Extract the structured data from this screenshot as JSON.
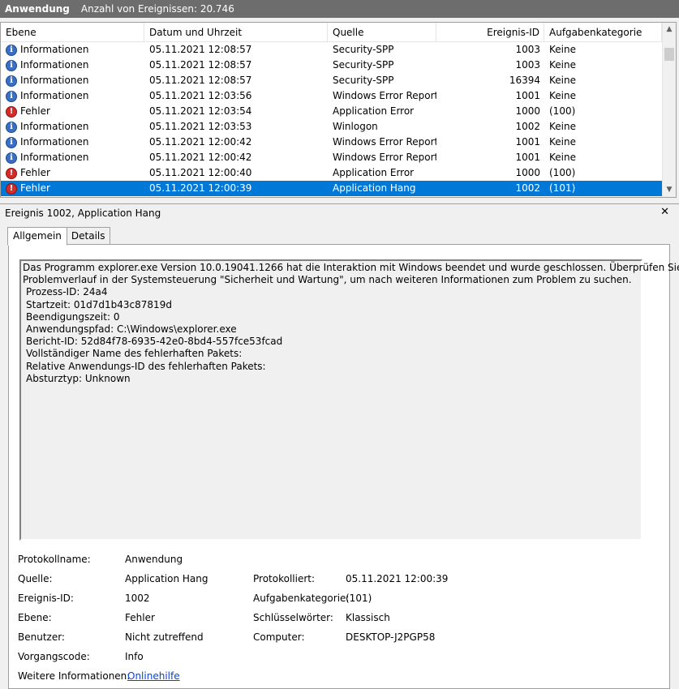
{
  "title": {
    "app": "Anwendung",
    "count": "Anzahl von Ereignissen: 20.746"
  },
  "columns": {
    "level": "Ebene",
    "date": "Datum und Uhrzeit",
    "source": "Quelle",
    "id": "Ereignis-ID",
    "category": "Aufgabenkategorie"
  },
  "rows": [
    {
      "icon": "info-icon",
      "level": "Informationen",
      "date": "05.11.2021 12:08:57",
      "source": "Security-SPP",
      "id": "1003",
      "category": "Keine"
    },
    {
      "icon": "info-icon",
      "level": "Informationen",
      "date": "05.11.2021 12:08:57",
      "source": "Security-SPP",
      "id": "1003",
      "category": "Keine"
    },
    {
      "icon": "info-icon",
      "level": "Informationen",
      "date": "05.11.2021 12:08:57",
      "source": "Security-SPP",
      "id": "16394",
      "category": "Keine"
    },
    {
      "icon": "info-icon",
      "level": "Informationen",
      "date": "05.11.2021 12:03:56",
      "source": "Windows Error Report...",
      "id": "1001",
      "category": "Keine"
    },
    {
      "icon": "error-icon",
      "level": "Fehler",
      "date": "05.11.2021 12:03:54",
      "source": "Application Error",
      "id": "1000",
      "category": "(100)"
    },
    {
      "icon": "info-icon",
      "level": "Informationen",
      "date": "05.11.2021 12:03:53",
      "source": "Winlogon",
      "id": "1002",
      "category": "Keine"
    },
    {
      "icon": "info-icon",
      "level": "Informationen",
      "date": "05.11.2021 12:00:42",
      "source": "Windows Error Report...",
      "id": "1001",
      "category": "Keine"
    },
    {
      "icon": "info-icon",
      "level": "Informationen",
      "date": "05.11.2021 12:00:42",
      "source": "Windows Error Report...",
      "id": "1001",
      "category": "Keine"
    },
    {
      "icon": "error-icon",
      "level": "Fehler",
      "date": "05.11.2021 12:00:40",
      "source": "Application Error",
      "id": "1000",
      "category": "(100)"
    },
    {
      "icon": "error-icon",
      "level": "Fehler",
      "date": "05.11.2021 12:00:39",
      "source": "Application Hang",
      "id": "1002",
      "category": "(101)",
      "selected": true
    }
  ],
  "detail": {
    "header": "Ereignis 1002, Application Hang",
    "close": "✕",
    "tab_general": "Allgemein",
    "tab_details": "Details"
  },
  "message": [
    "Das Programm explorer.exe Version 10.0.19041.1266 hat die Interaktion mit Windows beendet und wurde geschlossen. Überprüfen Sie den",
    "Problemverlauf in der Systemsteuerung \"Sicherheit und Wartung\", um nach weiteren Informationen zum Problem zu suchen.",
    " Prozess-ID: 24a4",
    " Startzeit: 01d7d1b43c87819d",
    " Beendigungszeit: 0",
    " Anwendungspfad: C:\\Windows\\explorer.exe",
    " Bericht-ID: 52d84f78-6935-42e0-8bd4-557fce53fcad",
    " Vollständiger Name des fehlerhaften Pakets:",
    " Relative Anwendungs-ID des fehlerhaften Pakets:",
    " Absturztyp: Unknown"
  ],
  "properties": {
    "logname_label": "Protokollname:",
    "logname_value": "Anwendung",
    "source_label": "Quelle:",
    "source_value": "Application Hang",
    "logged_label": "Protokolliert:",
    "logged_value": "05.11.2021 12:00:39",
    "eventid_label": "Ereignis-ID:",
    "eventid_value": "1002",
    "taskcat_label": "Aufgabenkategorie:",
    "taskcat_value": "(101)",
    "level_label": "Ebene:",
    "level_value": "Fehler",
    "keywords_label": "Schlüsselwörter:",
    "keywords_value": "Klassisch",
    "user_label": "Benutzer:",
    "user_value": "Nicht zutreffend",
    "computer_label": "Computer:",
    "computer_value": "DESKTOP-J2PGP58",
    "opcode_label": "Vorgangscode:",
    "opcode_value": "Info",
    "moreinfo_label": "Weitere Informationen:",
    "moreinfo_link": "Onlinehilfe"
  },
  "colors": {
    "selection": "#0078d7",
    "titlebar": "#6d6d6d",
    "link": "#0645d6"
  }
}
